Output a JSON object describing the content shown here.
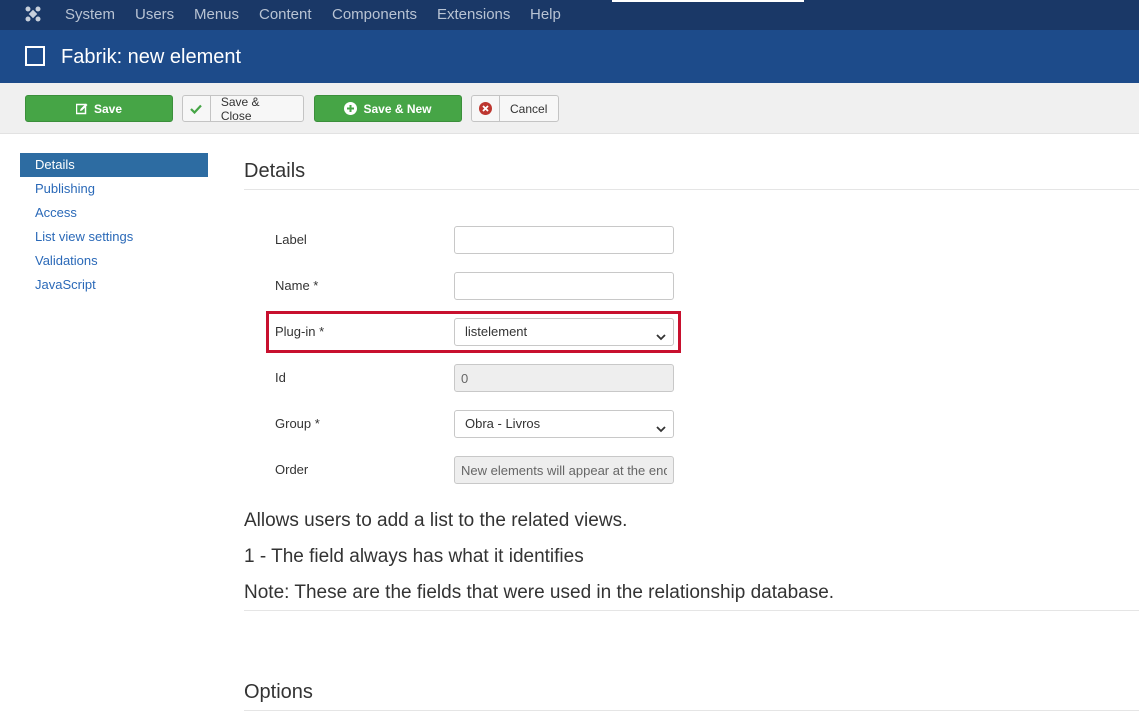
{
  "menubar": {
    "logo_icon": "joomla-logo-icon",
    "items": [
      "System",
      "Users",
      "Menus",
      "Content",
      "Components",
      "Extensions",
      "Help"
    ]
  },
  "titlebar": {
    "icon": "checkbox-square-icon",
    "title": "Fabrik: new element"
  },
  "toolbar": {
    "save_label": "Save",
    "save_close_label": "Save & Close",
    "save_new_label": "Save & New",
    "cancel_label": "Cancel"
  },
  "sidebar": {
    "items": [
      {
        "label": "Details",
        "active": true
      },
      {
        "label": "Publishing"
      },
      {
        "label": "Access"
      },
      {
        "label": "List view settings"
      },
      {
        "label": "Validations"
      },
      {
        "label": "JavaScript"
      }
    ]
  },
  "details": {
    "heading": "Details",
    "fields": {
      "label": {
        "label": "Label",
        "value": ""
      },
      "name": {
        "label": "Name *",
        "value": ""
      },
      "plugin": {
        "label": "Plug-in *",
        "value": "listelement"
      },
      "id": {
        "label": "Id",
        "value": "0"
      },
      "group": {
        "label": "Group *",
        "value": "Obra - Livros"
      },
      "order": {
        "label": "Order",
        "value": "New elements will appear at the end"
      }
    }
  },
  "description": {
    "line1": "Allows users to add a list to the related views.",
    "line2": "1 - The field always has what it identifies",
    "line3": "Note: These are the fields that were used in the relationship database."
  },
  "options": {
    "heading": "Options"
  },
  "colors": {
    "menubar": "#1a3867",
    "titlebar": "#1d4b8a",
    "success": "#46a546",
    "highlight": "#c8102e",
    "active_nav": "#2d6ca2"
  }
}
